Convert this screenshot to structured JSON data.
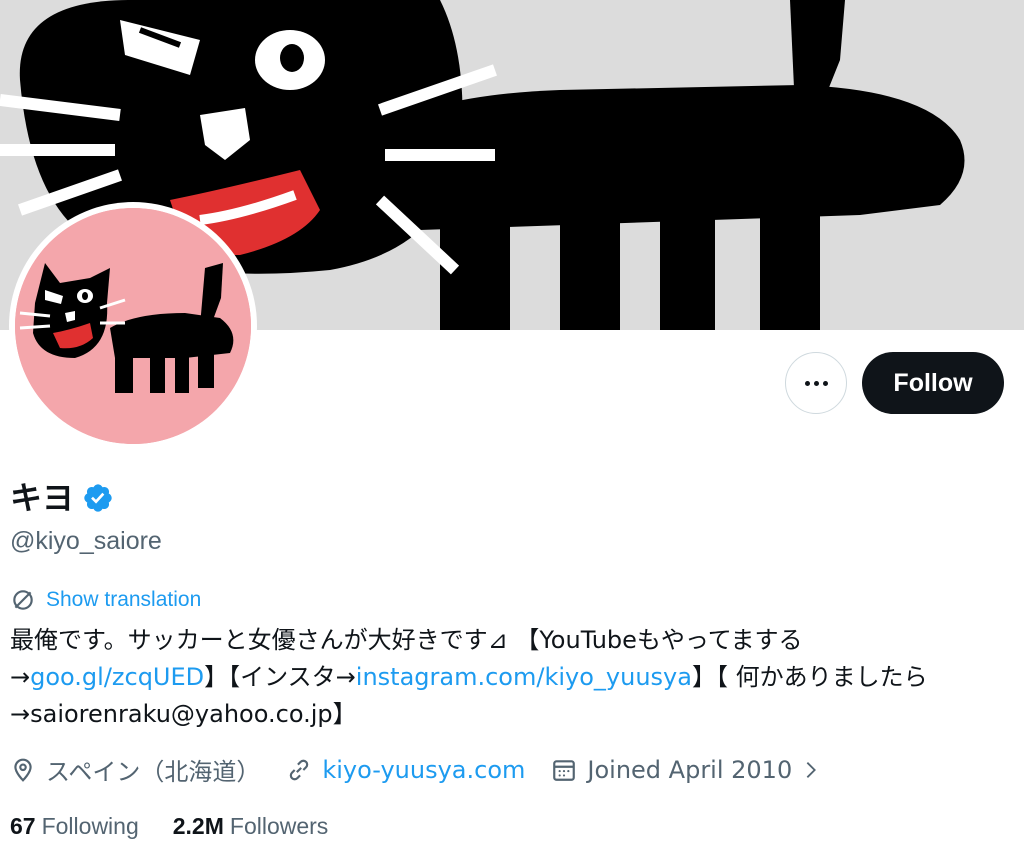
{
  "profile": {
    "name": "キヨ",
    "handle": "@kiyo_saiore",
    "show_translation": "Show translation",
    "bio": {
      "line1": "最俺です。サッカーと女優さんが大好きです⊿ 【YouTubeもやってまする",
      "line2_prefix": "→",
      "line2_link1": "goo.gl/zcqUED",
      "line2_mid": "】【インスタ→",
      "line2_link2": "instagram.com/kiyo_yuusya",
      "line2_suffix": "】【 何かありましたら",
      "line3": "→saiorenraku@yahoo.co.jp】"
    },
    "location": "スペイン（北海道）",
    "website": "kiyo-yuusya.com",
    "joined": "Joined April 2010",
    "following_count": "67",
    "following_label": "Following",
    "followers_count": "2.2M",
    "followers_label": "Followers"
  },
  "actions": {
    "follow_label": "Follow"
  },
  "colors": {
    "accent": "#1d9bf0",
    "avatar_bg": "#f4a6ab",
    "banner_bg": "#dcdcdc",
    "button_dark": "#0f1419"
  },
  "icons": {
    "more": "more-icon",
    "verified": "verified-badge-icon",
    "translate": "translate-icon",
    "location": "location-pin-icon",
    "link": "link-icon",
    "calendar": "calendar-icon",
    "chevron": "chevron-right-icon"
  }
}
